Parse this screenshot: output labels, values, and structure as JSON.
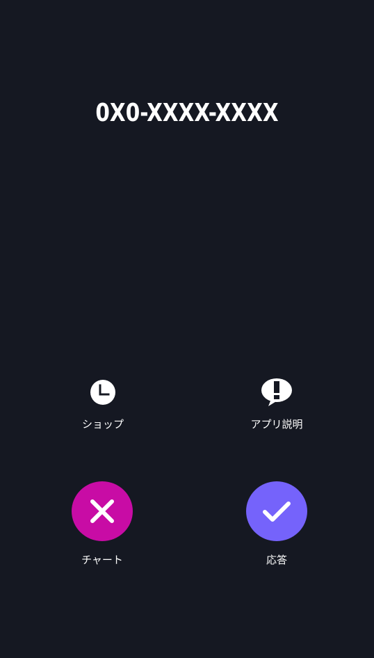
{
  "call": {
    "number": "0X0-XXXX-XXXX"
  },
  "actions": {
    "shop": {
      "label": "ショップ",
      "icon": "clock-icon"
    },
    "about": {
      "label": "アプリ説明",
      "icon": "speech-bubble-exclamation-icon"
    },
    "chart": {
      "label": "チャート",
      "icon": "close-icon"
    },
    "answer": {
      "label": "応答",
      "icon": "check-icon"
    }
  },
  "colors": {
    "background": "#151822",
    "decline": "#c80ca5",
    "answer": "#7563fb",
    "text": "#ffffff"
  }
}
